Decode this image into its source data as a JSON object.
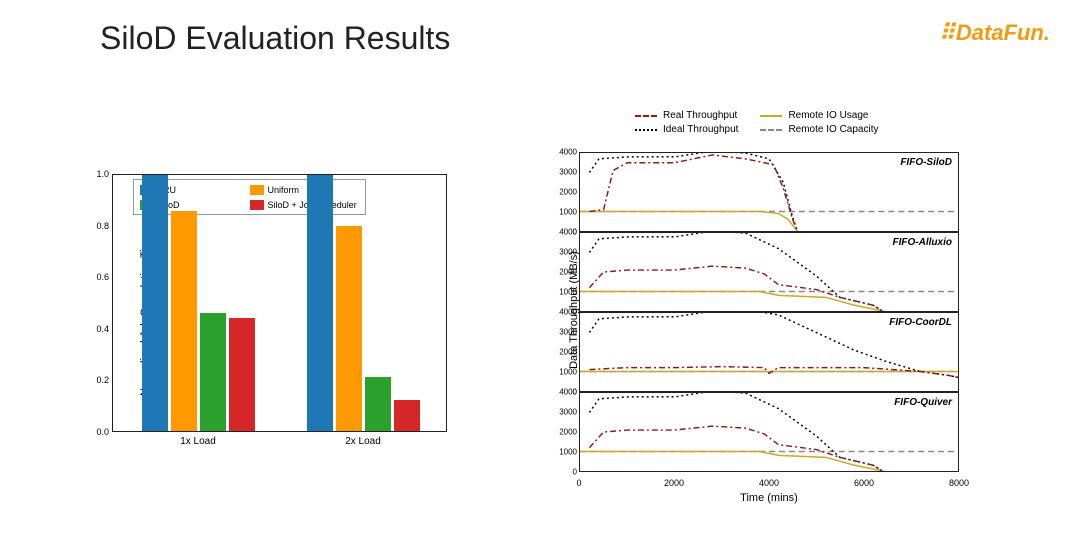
{
  "title": "SiloD Evaluation Results",
  "logo": {
    "text": "DataFun."
  },
  "chart_data": [
    {
      "type": "bar",
      "title": "",
      "ylabel": "Normalized Job Completion Time",
      "xlabel": "",
      "categories": [
        "1x Load",
        "2x Load"
      ],
      "series": [
        {
          "name": "LRU",
          "color": "#1f77b4",
          "values": [
            1.0,
            1.0
          ]
        },
        {
          "name": "Uniform",
          "color": "#ff9900",
          "values": [
            0.86,
            0.8
          ]
        },
        {
          "name": "SiloD",
          "color": "#2ca02c",
          "values": [
            0.46,
            0.21
          ]
        },
        {
          "name": "SiloD + Job Scheduler",
          "color": "#d62728",
          "values": [
            0.44,
            0.12
          ]
        }
      ],
      "ylim": [
        0.0,
        1.0
      ],
      "yticks": [
        0.0,
        0.2,
        0.4,
        0.6,
        0.8,
        1.0
      ]
    },
    {
      "type": "line",
      "xlabel": "Time (mins)",
      "ylabel": "Data Throughput (MB/s)",
      "xlim": [
        0,
        8000
      ],
      "xticks": [
        0,
        2000,
        4000,
        6000,
        8000
      ],
      "ylim": [
        0,
        4000
      ],
      "yticks": [
        0,
        1000,
        2000,
        3000,
        4000
      ],
      "legend": [
        {
          "name": "Real Throughput",
          "color": "#8b1a1a",
          "style": "dashdot"
        },
        {
          "name": "Remote IO Usage",
          "color": "#c9a82a",
          "style": "solid"
        },
        {
          "name": "Ideal Throughput",
          "color": "#000000",
          "style": "dotted"
        },
        {
          "name": "Remote IO Capacity",
          "color": "#888888",
          "style": "dashed"
        }
      ],
      "panels": [
        {
          "label": "FIFO-SiloD",
          "series": {
            "ideal": [
              [
                200,
                3000
              ],
              [
                400,
                3700
              ],
              [
                1000,
                3800
              ],
              [
                2000,
                3800
              ],
              [
                2800,
                4100
              ],
              [
                3500,
                4000
              ],
              [
                4000,
                3700
              ],
              [
                4300,
                2500
              ],
              [
                4500,
                700
              ],
              [
                4600,
                0
              ]
            ],
            "real": [
              [
                200,
                1000
              ],
              [
                500,
                1100
              ],
              [
                700,
                3100
              ],
              [
                1000,
                3500
              ],
              [
                2000,
                3500
              ],
              [
                2800,
                3900
              ],
              [
                3500,
                3700
              ],
              [
                4100,
                3400
              ],
              [
                4300,
                2200
              ],
              [
                4500,
                600
              ],
              [
                4600,
                0
              ]
            ],
            "io_usage": [
              [
                0,
                1000
              ],
              [
                3800,
                1000
              ],
              [
                4200,
                900
              ],
              [
                4400,
                600
              ],
              [
                4600,
                0
              ]
            ],
            "io_cap": [
              [
                0,
                1000
              ],
              [
                8000,
                1000
              ]
            ]
          }
        },
        {
          "label": "FIFO-Alluxio",
          "series": {
            "ideal": [
              [
                200,
                3000
              ],
              [
                400,
                3700
              ],
              [
                1000,
                3800
              ],
              [
                2000,
                3800
              ],
              [
                2800,
                4100
              ],
              [
                3500,
                4000
              ],
              [
                4200,
                3200
              ],
              [
                5000,
                1800
              ],
              [
                5500,
                700
              ],
              [
                6200,
                300
              ],
              [
                6400,
                0
              ]
            ],
            "real": [
              [
                200,
                1200
              ],
              [
                500,
                2000
              ],
              [
                1000,
                2100
              ],
              [
                2000,
                2100
              ],
              [
                2800,
                2300
              ],
              [
                3500,
                2200
              ],
              [
                3900,
                1900
              ],
              [
                4200,
                1350
              ],
              [
                5000,
                1100
              ],
              [
                5500,
                700
              ],
              [
                6200,
                300
              ],
              [
                6400,
                0
              ]
            ],
            "io_usage": [
              [
                0,
                1000
              ],
              [
                3800,
                1000
              ],
              [
                4200,
                800
              ],
              [
                5200,
                700
              ],
              [
                5800,
                300
              ],
              [
                6400,
                0
              ]
            ],
            "io_cap": [
              [
                0,
                1000
              ],
              [
                8000,
                1000
              ]
            ]
          }
        },
        {
          "label": "FIFO-CoorDL",
          "series": {
            "ideal": [
              [
                200,
                3000
              ],
              [
                400,
                3700
              ],
              [
                1000,
                3800
              ],
              [
                2000,
                3800
              ],
              [
                2800,
                4100
              ],
              [
                3500,
                4200
              ],
              [
                4200,
                3900
              ],
              [
                5000,
                3000
              ],
              [
                5800,
                2100
              ],
              [
                6500,
                1500
              ],
              [
                7200,
                1000
              ],
              [
                7800,
                800
              ],
              [
                8000,
                700
              ]
            ],
            "real": [
              [
                200,
                1100
              ],
              [
                1000,
                1200
              ],
              [
                2000,
                1200
              ],
              [
                3000,
                1250
              ],
              [
                3900,
                1200
              ],
              [
                4000,
                900
              ],
              [
                4200,
                1200
              ],
              [
                5000,
                1200
              ],
              [
                6000,
                1200
              ],
              [
                7200,
                1000
              ],
              [
                7800,
                800
              ],
              [
                8000,
                700
              ]
            ],
            "io_usage": [
              [
                0,
                1000
              ],
              [
                8000,
                1000
              ]
            ],
            "io_cap": [
              [
                0,
                1000
              ],
              [
                8000,
                1000
              ]
            ]
          }
        },
        {
          "label": "FIFO-Quiver",
          "series": {
            "ideal": [
              [
                200,
                3000
              ],
              [
                400,
                3700
              ],
              [
                1000,
                3800
              ],
              [
                2000,
                3800
              ],
              [
                2800,
                4100
              ],
              [
                3500,
                4000
              ],
              [
                4200,
                3200
              ],
              [
                5000,
                1800
              ],
              [
                5500,
                700
              ],
              [
                6200,
                300
              ],
              [
                6400,
                0
              ]
            ],
            "real": [
              [
                200,
                1200
              ],
              [
                500,
                2000
              ],
              [
                1000,
                2100
              ],
              [
                2000,
                2100
              ],
              [
                2800,
                2300
              ],
              [
                3500,
                2200
              ],
              [
                3900,
                1900
              ],
              [
                4200,
                1350
              ],
              [
                5000,
                1100
              ],
              [
                5500,
                700
              ],
              [
                6200,
                300
              ],
              [
                6400,
                0
              ]
            ],
            "io_usage": [
              [
                0,
                1000
              ],
              [
                3800,
                1000
              ],
              [
                4200,
                800
              ],
              [
                5200,
                700
              ],
              [
                5800,
                300
              ],
              [
                6400,
                0
              ]
            ],
            "io_cap": [
              [
                0,
                1000
              ],
              [
                8000,
                1000
              ]
            ]
          }
        }
      ]
    }
  ]
}
